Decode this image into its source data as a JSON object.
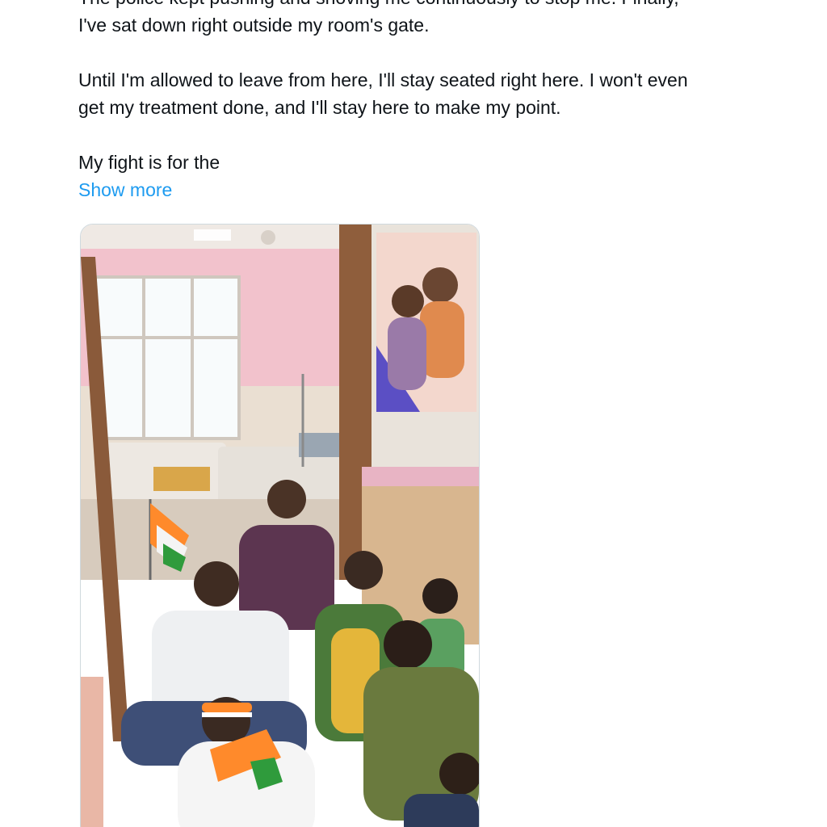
{
  "tweet": {
    "partial_line": "The police kept pushing and shoving me continuously to stop me. Finally,",
    "line_2": "I've sat down right outside my room's gate.",
    "line_3": "Until I'm allowed to leave from here, I'll stay seated right here. I won't even",
    "line_4": "get my treatment done, and I'll stay here to make my point.",
    "line_5": "My fight is for the",
    "show_more": "Show more"
  },
  "colors": {
    "text": "#0f1419",
    "link": "#1d9bf0",
    "border": "#cfd9de"
  },
  "media": {
    "type": "photo",
    "icons": [
      "flag-icon"
    ]
  }
}
